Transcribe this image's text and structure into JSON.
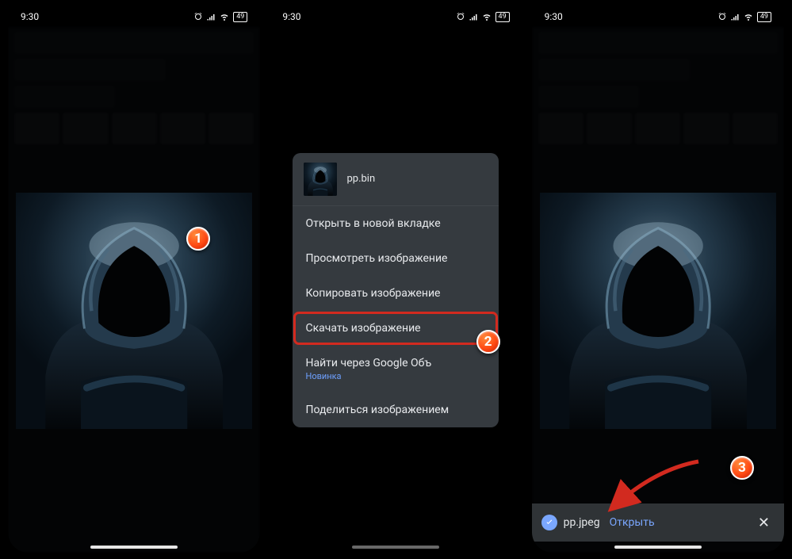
{
  "status": {
    "time": "9:30",
    "battery": "49"
  },
  "context_menu": {
    "filename": "pp.bin",
    "items": [
      {
        "label": "Открыть в новой вкладке"
      },
      {
        "label": "Просмотреть изображение"
      },
      {
        "label": "Копировать изображение"
      },
      {
        "label": "Скачать изображение",
        "highlighted": true
      },
      {
        "label": "Найти через Google Объ",
        "sublabel": "Новинка"
      },
      {
        "label": "Поделиться изображением"
      }
    ]
  },
  "snackbar": {
    "filename": "pp.jpeg",
    "action": "Открыть"
  },
  "annotations": {
    "badge1": "1",
    "badge2": "2",
    "badge3": "3"
  }
}
